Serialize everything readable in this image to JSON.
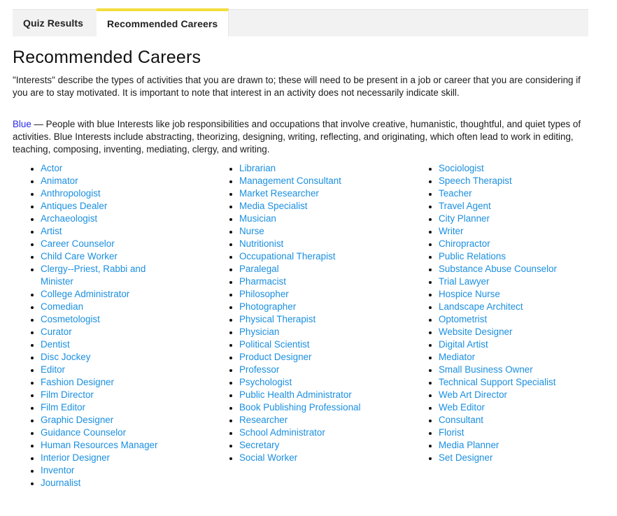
{
  "tabs": [
    {
      "label": "Quiz Results",
      "active": false
    },
    {
      "label": "Recommended Careers",
      "active": true
    }
  ],
  "colors": {
    "active_tab_accent": "#f5dc3c",
    "link": "#1a8fe0",
    "blue_interest": "#2a2ae8",
    "tabbar_bg": "#f2f2f2"
  },
  "page_title": "Recommended Careers",
  "intro": "\"Interests\" describe the types of activities that you are drawn to; these will need to be present in a job or career that you are considering if you are to stay motivated. It is important to note that interest in an activity does not necessarily indicate skill.",
  "interest": {
    "color_name": "Blue",
    "description": " — People with blue Interests like job responsibilities and occupations that involve creative, humanistic, thoughtful, and quiet types of activities. Blue Interests include abstracting, theorizing, designing, writing, reflecting, and originating, which often lead to work in editing, teaching, composing, inventing, mediating, clergy, and writing."
  },
  "careers": {
    "column1": [
      "Actor",
      "Animator",
      "Anthropologist",
      "Antiques Dealer",
      "Archaeologist",
      "Artist",
      "Career Counselor",
      "Child Care Worker",
      "Clergy--Priest, Rabbi and Minister",
      "College Administrator",
      "Comedian",
      "Cosmetologist",
      "Curator",
      "Dentist",
      "Disc Jockey",
      "Editor",
      "Fashion Designer",
      "Film Director",
      "Film Editor",
      "Graphic Designer",
      "Guidance Counselor",
      "Human Resources Manager",
      "Interior Designer",
      "Inventor",
      "Journalist"
    ],
    "column2": [
      "Librarian",
      "Management Consultant",
      "Market Researcher",
      "Media Specialist",
      "Musician",
      "Nurse",
      "Nutritionist",
      "Occupational Therapist",
      "Paralegal",
      "Pharmacist",
      "Philosopher",
      "Photographer",
      "Physical Therapist",
      "Physician",
      "Political Scientist",
      "Product Designer",
      "Professor",
      "Psychologist",
      "Public Health Administrator",
      "Book Publishing Professional",
      "Researcher",
      "School Administrator",
      "Secretary",
      "Social Worker"
    ],
    "column3": [
      "Sociologist",
      "Speech Therapist",
      "Teacher",
      "Travel Agent",
      "City Planner",
      "Writer",
      "Chiropractor",
      "Public Relations",
      "Substance Abuse Counselor",
      "Trial Lawyer",
      "Hospice Nurse",
      "Landscape Architect",
      "Optometrist",
      "Website Designer",
      "Digital Artist",
      "Mediator",
      "Small Business Owner",
      "Technical Support Specialist",
      "Web Art Director",
      "Web Editor",
      "Consultant",
      "Florist",
      "Media Planner",
      "Set Designer"
    ]
  }
}
